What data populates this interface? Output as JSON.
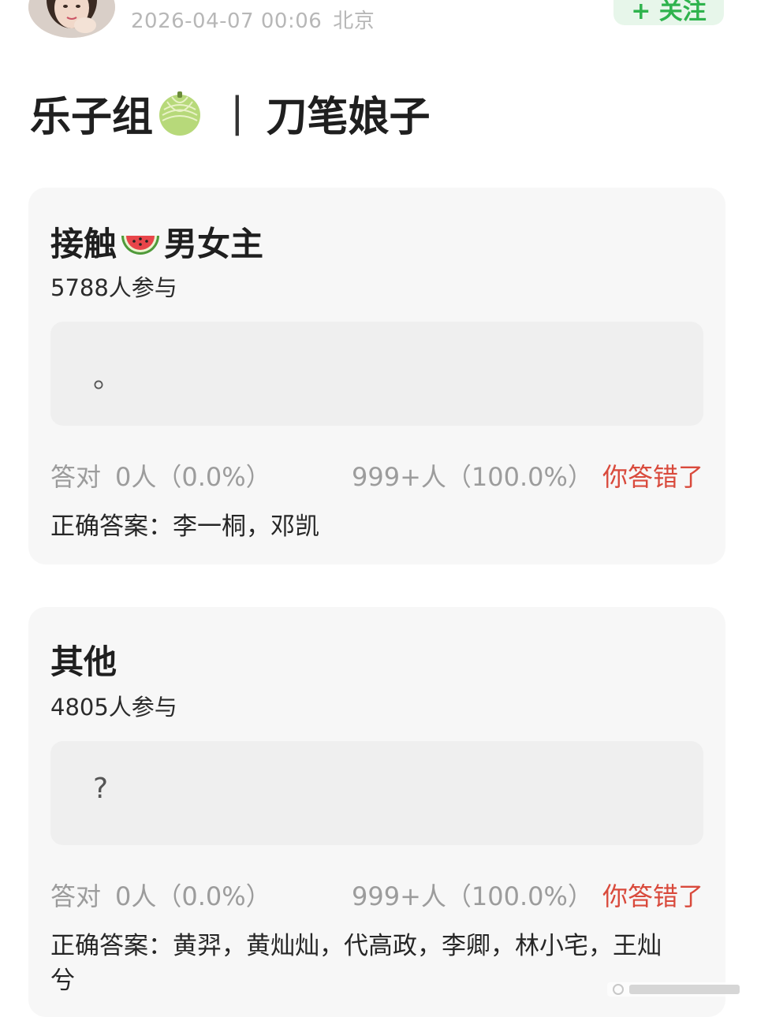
{
  "header": {
    "timestamp": "2026-04-07 00:06",
    "location": "北京",
    "follow_label": "+ 关注"
  },
  "post": {
    "title_left": "乐子组",
    "title_emoji": "melon-icon",
    "title_separator": "|",
    "title_right": "刀笔娘子"
  },
  "quizzes": [
    {
      "title_before": "接触",
      "title_emoji": "watermelon-icon",
      "title_after": "男女主",
      "participants": "5788人参与",
      "answer": "。",
      "correct_label": "答对",
      "correct_count": "0人（0.0%）",
      "wrong_count": "999+人（100.0%）",
      "verdict": "你答错了",
      "correct_answer_label": "正确答案：",
      "correct_answer": "李一桐，邓凯"
    },
    {
      "title": "其他",
      "participants": "4805人参与",
      "answer": "?",
      "correct_label": "答对",
      "correct_count": "0人（0.0%）",
      "wrong_count": "999+人（100.0%）",
      "verdict": "你答错了",
      "correct_answer_label": "正确答案：",
      "correct_answer": "黄羿，黄灿灿，代高政，李卿，林小宅，王灿兮"
    }
  ],
  "colors": {
    "verdict": "#d94a3c",
    "follow": "#2fb34d",
    "card_bg": "#f7f7f7"
  }
}
